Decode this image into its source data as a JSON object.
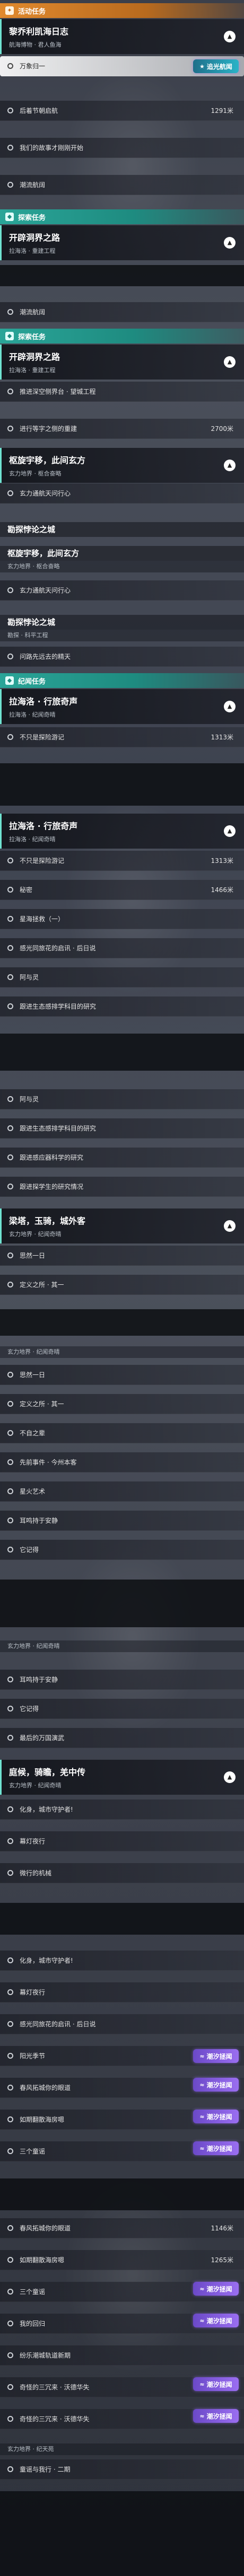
{
  "sections": {
    "events": "活动任务",
    "explore": "探索任务",
    "exploreB": "探索任务",
    "story": "纪闻任务"
  },
  "quests": {
    "q1": {
      "title": "黎乔利凯海日志",
      "sub": "航海博物 · 君人鱼海"
    },
    "q2": {
      "title": "开辟洞界之路",
      "sub": "拉海洛 · 重建工程"
    },
    "q3": {
      "title": "开辟洞界之路",
      "sub": "拉海洛 · 重建工程"
    },
    "q4": {
      "title": "枢旋宇移，此间玄方",
      "sub": "玄力地界 · 枢合奋略"
    },
    "q5": {
      "title": "拉海洛 · 行旅奇声",
      "sub": "拉海洛 · 纪闻奇晴"
    },
    "q6": {
      "title": "拉海洛 · 行旅奇声",
      "sub": "拉海洛 · 纪闻奇晴"
    },
    "q7": {
      "title": "梁塔，玉骑，城外客",
      "sub": "玄力地界 · 纪闻奇晴"
    },
    "q8": {
      "title": "庭候，骑瞻，羌中传",
      "sub": "玄力地界 · 纪闻奇晴"
    }
  },
  "plain": {
    "p1": "枢旋宇移，此间玄方",
    "p1sub": "玄力地界 · 枢合奋略",
    "p2": "勘探悖论之城",
    "p2sub": "勘探 · 科平工程",
    "p3": "勘探悖论之城",
    "p3sub": "勘探 · 科平工程",
    "p4sub": "玄力地界 · 纪闻奇晴",
    "p5sub": "玄力地界 · 纪闻奇晴",
    "p6sub": "玄力地界 · 纪天苑"
  },
  "badges": {
    "b1": "追光航闻",
    "b2": "潮汐拯闻"
  },
  "items": {
    "i1": "万象归一",
    "i2": "后着节朝启航",
    "i2d": "1291米",
    "i3": "我们的故事才刚刚开始",
    "i4": "潮流航阔",
    "i5": "潮流航阔",
    "i6": "推进深空侧界台 · 望城工程",
    "i7": "进行等字之侧的重建",
    "i7d": "2700米",
    "i8": "玄力通航天问行心",
    "i9": "玄力通航天问行心",
    "i10": "问路先远去的精天",
    "i11": "不只是探险游记",
    "i11d": "1313米",
    "i12": "不只是探险游记",
    "i12d": "1313米",
    "i13": "秘密",
    "i13d": "1466米",
    "i14": "星海拯救（一）",
    "i15": "感光同旅花的启讯 · 后日说",
    "i16": "阿与灵",
    "i17": "跟进生态感排学科目的研究",
    "i18": "阿与灵",
    "i19": "跟进生态感排学科目的研究",
    "i20": "跟进感应器科学的研究",
    "i21": "跟进探学生的研究情况",
    "i22": "思然一日",
    "i23": "定义之所 · 其一",
    "i24": "思然一日",
    "i25": "定义之所 · 其一",
    "i26": "不自之辈",
    "i27": "先前事件 · 今州本客",
    "i28": "星火艺术",
    "i29": "耳鸣持于安静",
    "i30": "它记得",
    "i31": "耳鸣持于安静",
    "i32": "它记得",
    "i33": "最后的万国演武",
    "i34": "化身，城市守护者!",
    "i35": "幕灯夜行",
    "i36": "微行的机械",
    "i37": "化身，城市守护者!",
    "i38": "幕灯夜行",
    "i39": "感光同旅花的启讯 · 后日说",
    "i40": "阳光季节",
    "i41": "春风拓城你的眼道",
    "i41d": "1146米",
    "i42": "如期翻散海房嗯",
    "i42d": "1265米",
    "i43": "三个童谣",
    "i44": "春风拓城你的眼道",
    "i44d": "1146米",
    "i45": "如期翻散海房嗯",
    "i45d": "1265米",
    "i46": "三个童谣",
    "i47": "我的回归",
    "i48": "纷乐潮城轨道新期",
    "i49": "奇怪的三冗来 · 沃德华失",
    "i50": "奇怪的三冗来 · 沃德华失",
    "i51": "童谣与我行 · 二期"
  },
  "colors": {
    "accent_orange": "#e0892d",
    "accent_teal": "#2aa598",
    "badge_purple": "#7a55d8"
  }
}
